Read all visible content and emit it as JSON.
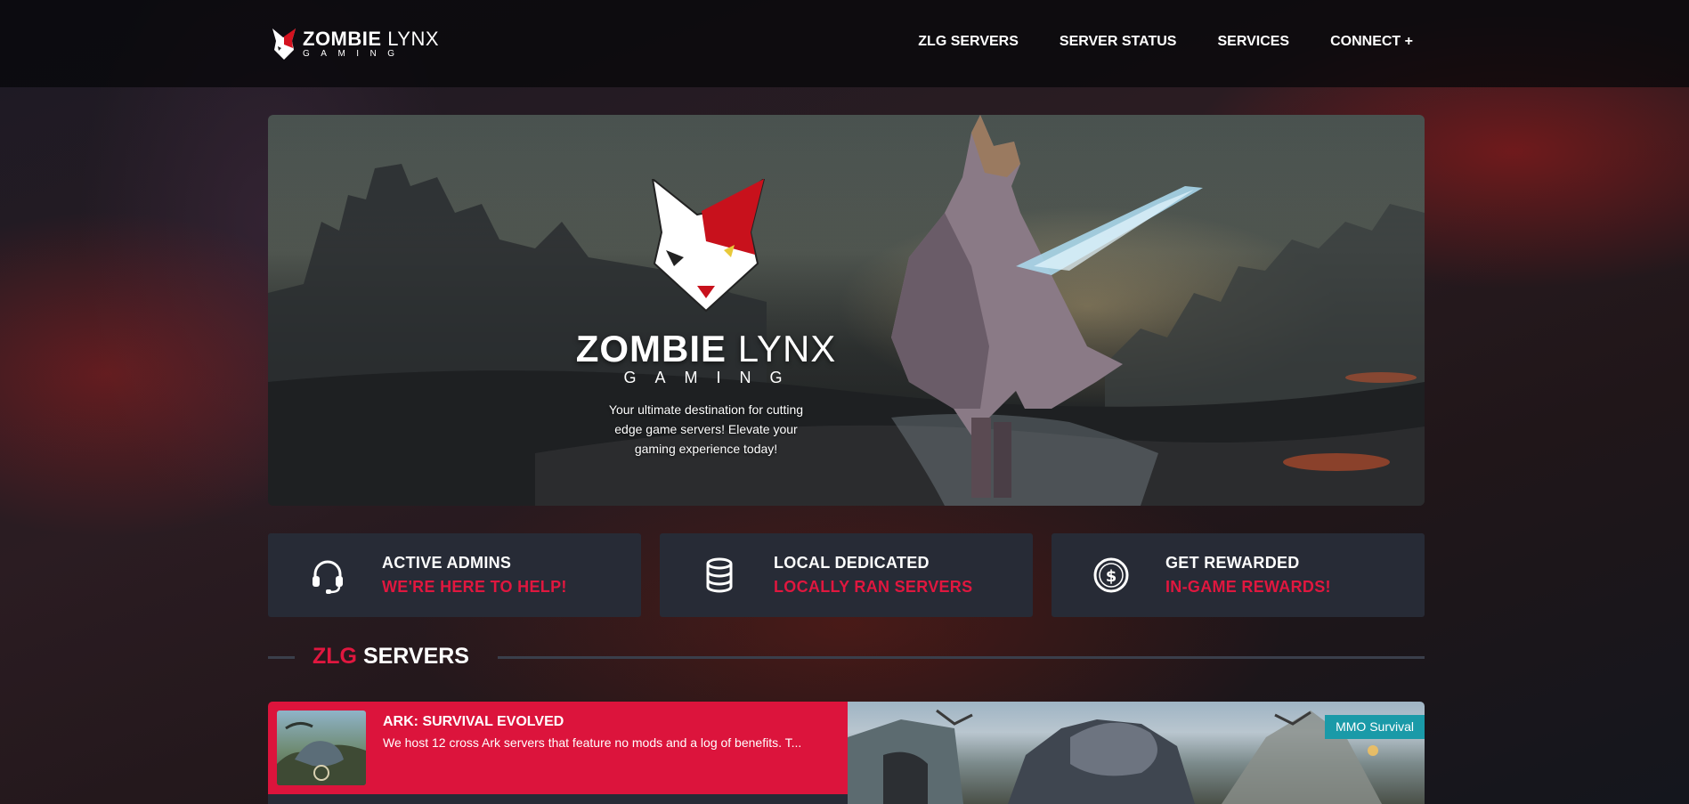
{
  "brand": {
    "name_bold": "ZOMBIE",
    "name_light": "LYNX",
    "sub": "GAMING"
  },
  "nav": [
    {
      "label": "ZLG SERVERS"
    },
    {
      "label": "SERVER STATUS"
    },
    {
      "label": "SERVICES"
    },
    {
      "label": "CONNECT +"
    }
  ],
  "hero": {
    "title_bold": "ZOMBIE",
    "title_light": "LYNX",
    "sub": "GAMING",
    "description": "Your ultimate destination for cutting edge game servers! Elevate your gaming experience today!"
  },
  "features": [
    {
      "icon": "headset-icon",
      "title": "ACTIVE ADMINS",
      "subtitle": "WE'RE HERE TO HELP!"
    },
    {
      "icon": "database-icon",
      "title": "LOCAL DEDICATED",
      "subtitle": "LOCALLY RAN SERVERS"
    },
    {
      "icon": "dollar-coin-icon",
      "title": "GET REWARDED",
      "subtitle": "IN-GAME REWARDS!"
    }
  ],
  "section": {
    "title_accent": "ZLG",
    "title_rest": "SERVERS"
  },
  "servers": [
    {
      "name": "ARK: SURVIVAL EVOLVED",
      "description": "We host 12 cross Ark servers that feature no mods and a log of benefits. T...",
      "badge": "MMO Survival"
    }
  ],
  "colors": {
    "accent": "#dc143c",
    "card": "#272b36",
    "badge": "#1a9aa8"
  }
}
